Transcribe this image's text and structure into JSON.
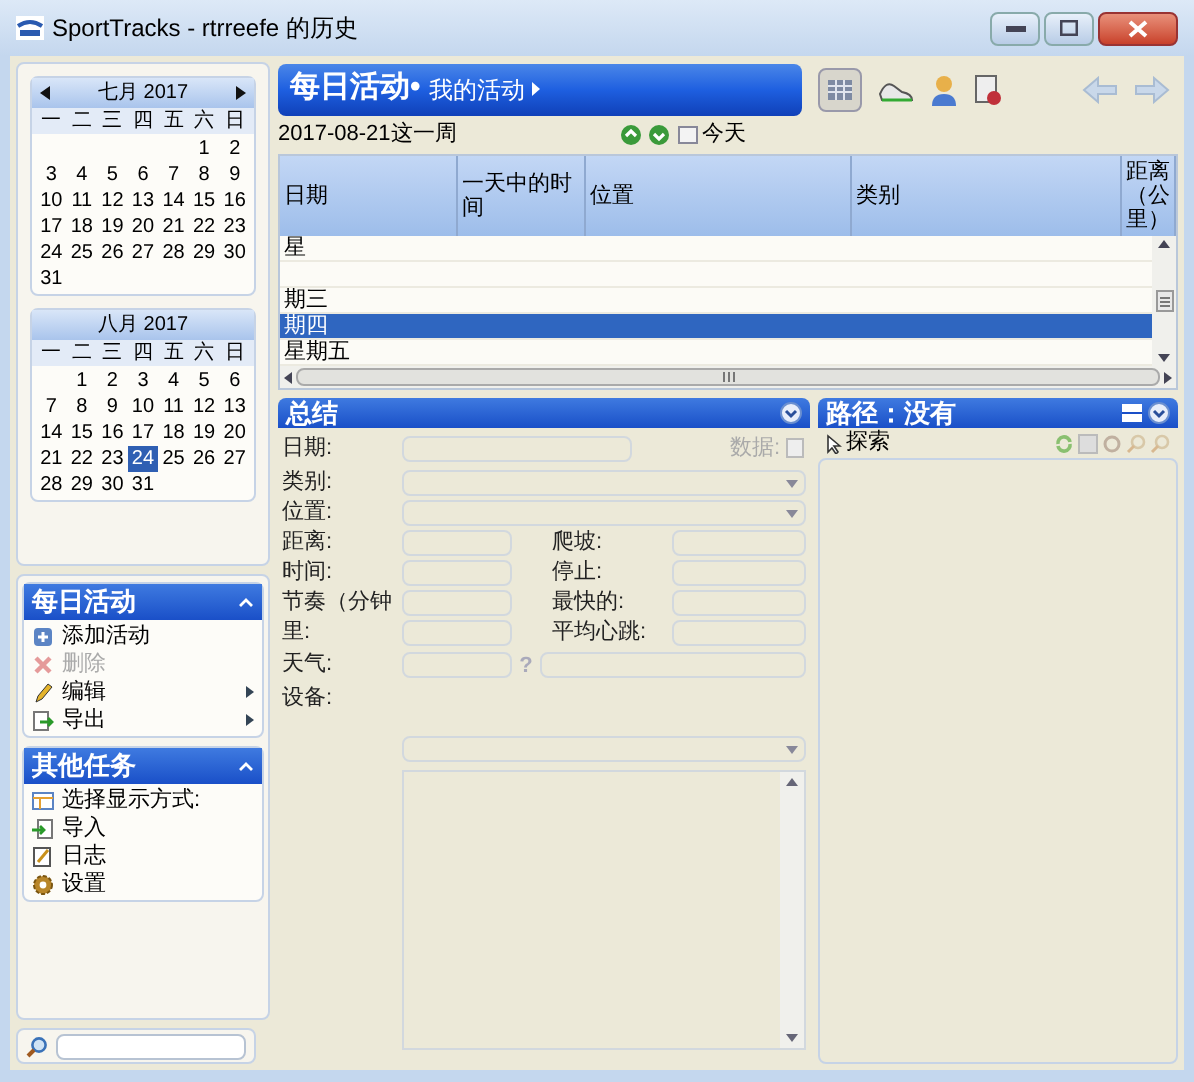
{
  "window": {
    "title": "SportTracks - rtrreefe 的历史"
  },
  "calendars": [
    {
      "title": "七月 2017",
      "nav": true,
      "weekdays": [
        "一",
        "二",
        "三",
        "四",
        "五",
        "六",
        "日"
      ],
      "weeks": [
        [
          {
            "d": "1",
            "selected": false
          },
          {
            "d": "2",
            "selected": false
          }
        ],
        [
          {
            "d": "3",
            "selected": false
          },
          {
            "d": "4",
            "selected": false
          },
          {
            "d": "5",
            "selected": false
          },
          {
            "d": "6",
            "selected": false
          },
          {
            "d": "7",
            "selected": false
          },
          {
            "d": "8",
            "selected": false
          },
          {
            "d": "9",
            "selected": false
          }
        ],
        [
          {
            "d": "10",
            "selected": false
          },
          {
            "d": "11",
            "selected": false
          },
          {
            "d": "12",
            "selected": false
          },
          {
            "d": "13",
            "selected": false
          },
          {
            "d": "14",
            "selected": false
          },
          {
            "d": "15",
            "selected": false
          },
          {
            "d": "16",
            "selected": false
          }
        ],
        [
          {
            "d": "17",
            "selected": false
          },
          {
            "d": "18",
            "selected": false
          },
          {
            "d": "19",
            "selected": false
          },
          {
            "d": "20",
            "selected": false
          },
          {
            "d": "21",
            "selected": false
          },
          {
            "d": "22",
            "selected": false
          },
          {
            "d": "23",
            "selected": false
          }
        ],
        [
          {
            "d": "24",
            "selected": false
          },
          {
            "d": "25",
            "selected": false
          },
          {
            "d": "26",
            "selected": false
          },
          {
            "d": "27",
            "selected": false
          },
          {
            "d": "28",
            "selected": false
          },
          {
            "d": "29",
            "selected": false
          },
          {
            "d": "30",
            "selected": false
          }
        ],
        [
          {
            "d": "31",
            "selected": false
          }
        ]
      ]
    },
    {
      "title": "八月 2017",
      "nav": false,
      "weekdays": [
        "一",
        "二",
        "三",
        "四",
        "五",
        "六",
        "日"
      ],
      "weeks": [
        [
          {
            "d": "1",
            "selected": false
          },
          {
            "d": "2",
            "selected": false
          },
          {
            "d": "3",
            "selected": false
          },
          {
            "d": "4",
            "selected": false
          },
          {
            "d": "5",
            "selected": false
          },
          {
            "d": "6",
            "selected": false
          }
        ],
        [
          {
            "d": "7",
            "selected": false
          },
          {
            "d": "8",
            "selected": false
          },
          {
            "d": "9",
            "selected": false
          },
          {
            "d": "10",
            "selected": false
          },
          {
            "d": "11",
            "selected": false
          },
          {
            "d": "12",
            "selected": false
          },
          {
            "d": "13",
            "selected": false
          }
        ],
        [
          {
            "d": "14",
            "selected": false
          },
          {
            "d": "15",
            "selected": false
          },
          {
            "d": "16",
            "selected": false
          },
          {
            "d": "17",
            "selected": false
          },
          {
            "d": "18",
            "selected": false
          },
          {
            "d": "19",
            "selected": false
          },
          {
            "d": "20",
            "selected": false
          }
        ],
        [
          {
            "d": "21",
            "selected": false
          },
          {
            "d": "22",
            "selected": false
          },
          {
            "d": "23",
            "selected": false
          },
          {
            "d": "24",
            "selected": true
          },
          {
            "d": "25",
            "selected": false
          },
          {
            "d": "26",
            "selected": false
          },
          {
            "d": "27",
            "selected": false
          }
        ],
        [
          {
            "d": "28",
            "selected": false
          },
          {
            "d": "29",
            "selected": false
          },
          {
            "d": "30",
            "selected": false
          },
          {
            "d": "31",
            "selected": false
          }
        ]
      ]
    }
  ],
  "task_panels": [
    {
      "title": "每日活动",
      "items": [
        {
          "label": "添加活动",
          "disabled": false,
          "submenu": false
        },
        {
          "label": "删除",
          "disabled": true,
          "submenu": false
        },
        {
          "label": "编辑",
          "disabled": false,
          "submenu": true
        },
        {
          "label": "导出",
          "disabled": false,
          "submenu": true
        }
      ]
    },
    {
      "title": "其他任务",
      "items": [
        {
          "label": "选择显示方式:",
          "disabled": false,
          "submenu": false
        },
        {
          "label": "导入",
          "disabled": false,
          "submenu": false
        },
        {
          "label": "日志",
          "disabled": false,
          "submenu": false
        },
        {
          "label": "设置",
          "disabled": false,
          "submenu": false
        }
      ]
    }
  ],
  "view_header": {
    "title": "每日活动•",
    "subtitle": "我的活动"
  },
  "week": {
    "label": "2017-08-21这一周",
    "today": "今天"
  },
  "table": {
    "columns": [
      "日期",
      "一天中的时间",
      "位置",
      "类别",
      "距离（公里）"
    ],
    "rows": [
      {
        "date": "星",
        "selected": false
      },
      {
        "selected": false
      },
      {
        "date": "期三",
        "selected": false
      },
      {
        "date": "期四",
        "selected": true
      },
      {
        "date": "星期五",
        "selected": false
      }
    ]
  },
  "summary": {
    "title": "总结",
    "data_label": "数据:",
    "rows": [
      {
        "label": "日期:",
        "kind": "text"
      },
      {
        "label": "类别:",
        "kind": "combo"
      },
      {
        "label": "位置:",
        "kind": "combo"
      }
    ],
    "pairs": [
      {
        "left": "距离:",
        "right": "爬坡:"
      },
      {
        "left": "时间:",
        "right": "停止:"
      },
      {
        "left": "节奏（分钟",
        "right": "最快的:"
      },
      {
        "left": "里:",
        "right": "平均心跳:"
      }
    ],
    "weather": "天气:",
    "help": "?",
    "equipment": "设备:"
  },
  "route": {
    "title": "路径：没有",
    "explore": "探索"
  }
}
